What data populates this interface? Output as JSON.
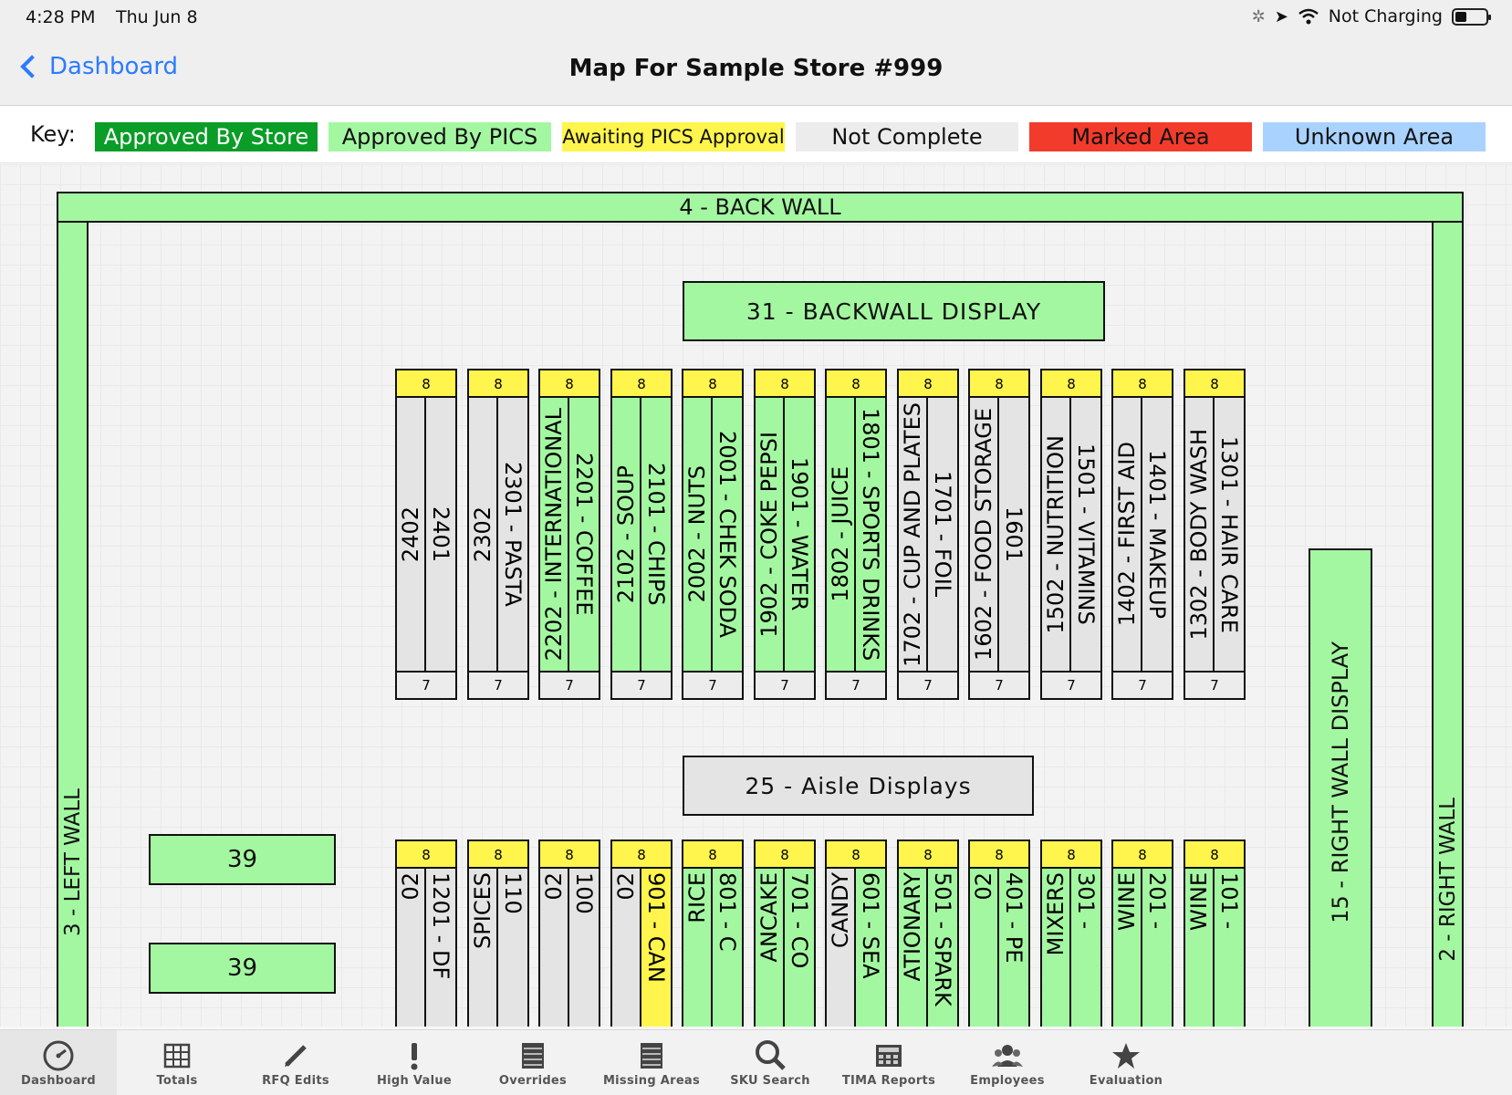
{
  "status_bar": {
    "time": "4:28 PM",
    "date": "Thu Jun 8",
    "charging": "Not Charging"
  },
  "header": {
    "back_label": "Dashboard",
    "title": "Map For Sample Store #999"
  },
  "key": {
    "label": "Key:",
    "items": [
      {
        "label": "Approved By Store",
        "color": "#0a9d27"
      },
      {
        "label": "Approved By PICS",
        "color": "#a4f7a1"
      },
      {
        "label": "Awaiting PICS Approval",
        "color": "#fff54c"
      },
      {
        "label": "Not Complete",
        "color": "#ececec"
      },
      {
        "label": "Marked Area",
        "color": "#f33b2c"
      },
      {
        "label": "Unknown Area",
        "color": "#a9d2ff"
      }
    ]
  },
  "map": {
    "back_wall": "4 - BACK WALL",
    "left_wall": "3 - LEFT WALL",
    "right_wall": "2 - RIGHT WALL",
    "right_wall_display": "15 - RIGHT WALL DISPLAY",
    "backwall_display": "31 - BACKWALL DISPLAY",
    "aisle_displays": "25 - Aisle Displays",
    "display_39_a": "39",
    "display_39_b": "39",
    "aisles_top": [
      {
        "top": "8",
        "bottom": "7",
        "left": "2402",
        "right": "2401",
        "lc": "gr",
        "rc": "gr"
      },
      {
        "top": "8",
        "bottom": "7",
        "left": "2302",
        "right": "2301 - PASTA",
        "lc": "gr",
        "rc": "gr"
      },
      {
        "top": "8",
        "bottom": "7",
        "left": "2202 - INTERNATIONAL",
        "right": "2201 - COFFEE",
        "lc": "g",
        "rc": "g"
      },
      {
        "top": "8",
        "bottom": "7",
        "left": "2102 - SOUP",
        "right": "2101 - CHIPS",
        "lc": "g",
        "rc": "g"
      },
      {
        "top": "8",
        "bottom": "7",
        "left": "2002 - NUTS",
        "right": "2001 - CHEK SODA",
        "lc": "g",
        "rc": "g"
      },
      {
        "top": "8",
        "bottom": "7",
        "left": "1902 - COKE PEPSI",
        "right": "1901 - WATER",
        "lc": "g",
        "rc": "g"
      },
      {
        "top": "8",
        "bottom": "7",
        "left": "1802 - JUICE",
        "right": "1801 - SPORTS DRINKS",
        "lc": "g",
        "rc": "g"
      },
      {
        "top": "8",
        "bottom": "7",
        "left": "1702 - CUP AND PLATES",
        "right": "1701 - FOIL",
        "lc": "gr",
        "rc": "gr"
      },
      {
        "top": "8",
        "bottom": "7",
        "left": "1602 - FOOD STORAGE",
        "right": "1601",
        "lc": "gr",
        "rc": "gr"
      },
      {
        "top": "8",
        "bottom": "7",
        "left": "1502 - NUTRITION",
        "right": "1501 - VITAMINS",
        "lc": "gr",
        "rc": "gr"
      },
      {
        "top": "8",
        "bottom": "7",
        "left": "1402 - FIRST AID",
        "right": "1401 - MAKEUP",
        "lc": "gr",
        "rc": "gr"
      },
      {
        "top": "8",
        "bottom": "7",
        "left": "1302 - BODY WASH",
        "right": "1301 - HAIR CARE",
        "lc": "gr",
        "rc": "gr"
      }
    ],
    "aisles_bottom": [
      {
        "top": "8",
        "left": "02",
        "right": "1201 - DF",
        "lc": "gr",
        "rc": "gr"
      },
      {
        "top": "8",
        "left": "SPICES",
        "right": "110",
        "lc": "gr",
        "rc": "gr"
      },
      {
        "top": "8",
        "left": "02",
        "right": "100",
        "lc": "gr",
        "rc": "gr"
      },
      {
        "top": "8",
        "left": "02",
        "right": "901 - CAN",
        "lc": "gr",
        "rc": "y"
      },
      {
        "top": "8",
        "left": "RICE",
        "right": "801 - C",
        "lc": "g",
        "rc": "g"
      },
      {
        "top": "8",
        "left": "ANCAKE",
        "right": "701 - CO",
        "lc": "g",
        "rc": "g"
      },
      {
        "top": "8",
        "left": "CANDY",
        "right": "601 - SEA",
        "lc": "gr",
        "rc": "g"
      },
      {
        "top": "8",
        "left": "ATIONARY",
        "right": "501 - SPARK",
        "lc": "g",
        "rc": "g"
      },
      {
        "top": "8",
        "left": "02",
        "right": "401 - PE",
        "lc": "g",
        "rc": "g"
      },
      {
        "top": "8",
        "left": "MIXERS",
        "right": "301 -",
        "lc": "g",
        "rc": "g"
      },
      {
        "top": "8",
        "left": "WINE",
        "right": "201 -",
        "lc": "g",
        "rc": "g"
      },
      {
        "top": "8",
        "left": "WINE",
        "right": "101 -",
        "lc": "g",
        "rc": "g"
      }
    ]
  },
  "tabs": [
    {
      "label": "Dashboard",
      "icon": "gauge-icon"
    },
    {
      "label": "Totals",
      "icon": "grid-icon"
    },
    {
      "label": "RFQ Edits",
      "icon": "pencil-icon"
    },
    {
      "label": "High Value",
      "icon": "exclamation-icon"
    },
    {
      "label": "Overrides",
      "icon": "list-icon"
    },
    {
      "label": "Missing Areas",
      "icon": "list-icon"
    },
    {
      "label": "SKU Search",
      "icon": "search-icon"
    },
    {
      "label": "TIMA Reports",
      "icon": "calculator-icon"
    },
    {
      "label": "Employees",
      "icon": "people-icon"
    },
    {
      "label": "Evaluation",
      "icon": "star-icon"
    }
  ]
}
